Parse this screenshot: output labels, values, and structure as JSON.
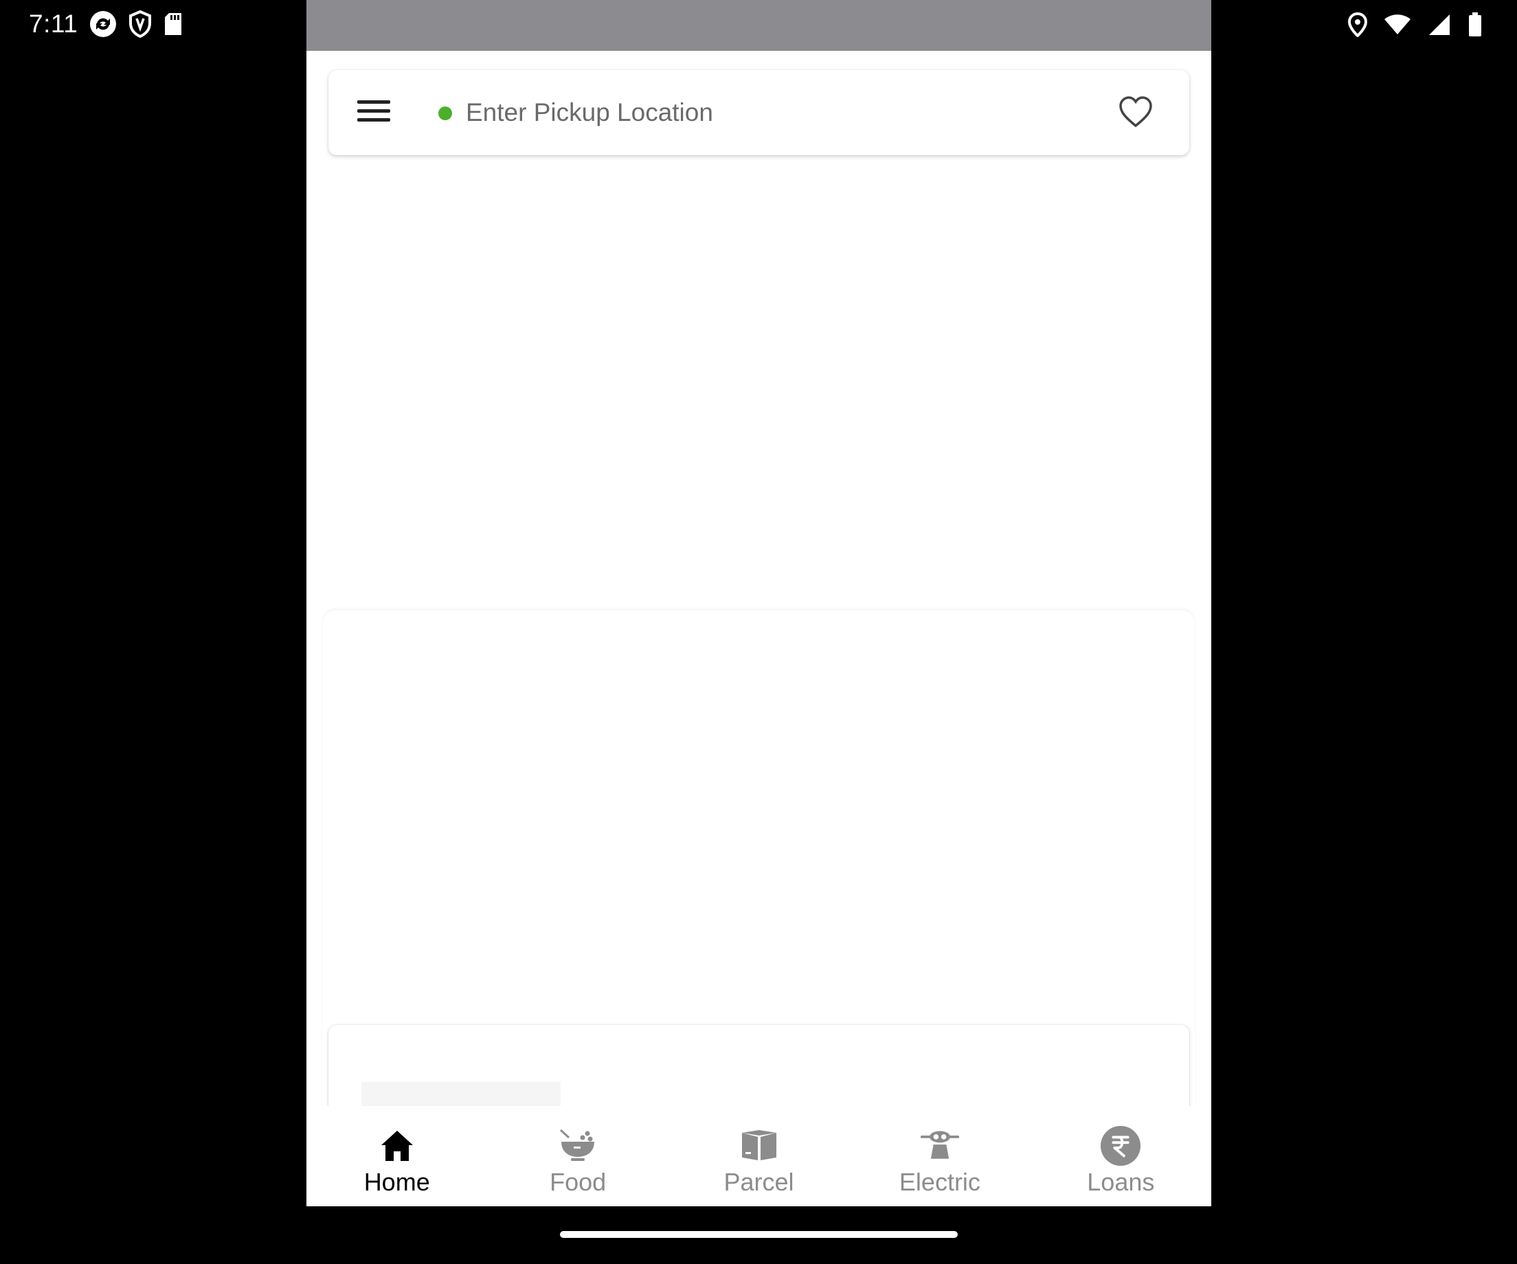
{
  "status_bar": {
    "time": "7:11",
    "left_icons": [
      "sync-icon",
      "shield-icon",
      "sd-card-icon"
    ],
    "right_icons": [
      "location-pin-icon",
      "wifi-icon",
      "cell-signal-icon",
      "battery-icon"
    ]
  },
  "search_bar": {
    "placeholder": "Enter Pickup Location",
    "value": "",
    "dot_color": "#4caf2a",
    "menu_icon": "hamburger-menu-icon",
    "favorite_icon": "heart-outline-icon"
  },
  "bottom_nav": {
    "active": "Home",
    "items": [
      {
        "label": "Home",
        "icon": "home-icon"
      },
      {
        "label": "Food",
        "icon": "food-bowl-icon"
      },
      {
        "label": "Parcel",
        "icon": "parcel-box-icon"
      },
      {
        "label": "Electric",
        "icon": "electric-scooter-icon"
      },
      {
        "label": "Loans",
        "icon": "rupee-icon"
      }
    ]
  }
}
